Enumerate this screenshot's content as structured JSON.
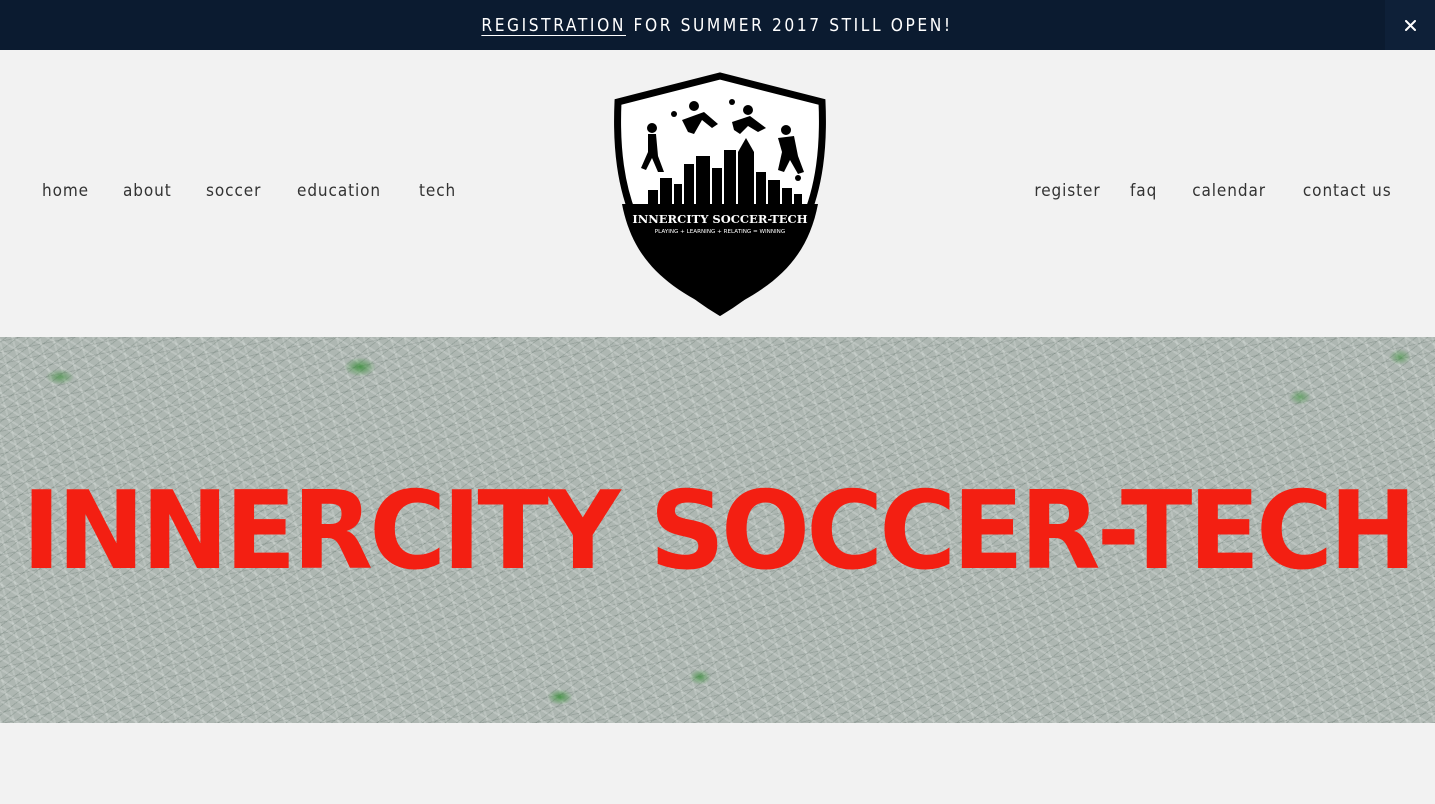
{
  "announcement": {
    "link_label": "REGISTRATION",
    "text": " FOR SUMMER 2017 STILL OPEN!",
    "close_icon": "close-icon",
    "background": "#0b1b30"
  },
  "nav_left": [
    {
      "label": "home"
    },
    {
      "label": "about"
    },
    {
      "label": "soccer"
    },
    {
      "label": "education"
    },
    {
      "label": "tech"
    }
  ],
  "nav_right": [
    {
      "label": "register"
    },
    {
      "label": "faq"
    },
    {
      "label": "calendar"
    },
    {
      "label": "contact us"
    }
  ],
  "logo": {
    "title": "INNERCITY SOCCER-TECH",
    "tagline": "PLAYING + LEARNING + RELATING = WINNING"
  },
  "hero": {
    "title": "INNERCITY SOCCER-TECH",
    "title_color": "#f31f12"
  }
}
